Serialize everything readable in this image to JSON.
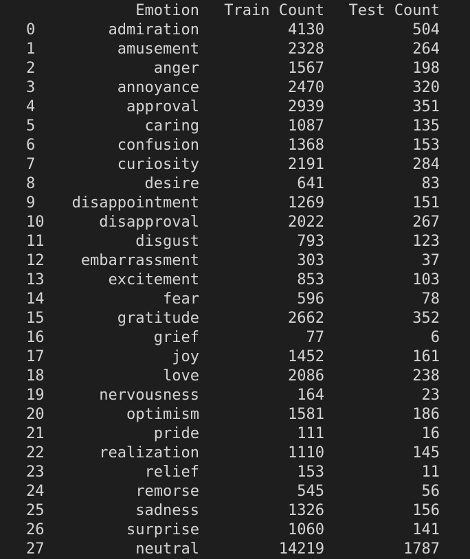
{
  "columns": {
    "index": "",
    "emotion": "Emotion",
    "train": "Train Count",
    "test": "Test Count"
  },
  "rows": [
    {
      "index": "0",
      "emotion": "admiration",
      "train": "4130",
      "test": "504"
    },
    {
      "index": "1",
      "emotion": "amusement",
      "train": "2328",
      "test": "264"
    },
    {
      "index": "2",
      "emotion": "anger",
      "train": "1567",
      "test": "198"
    },
    {
      "index": "3",
      "emotion": "annoyance",
      "train": "2470",
      "test": "320"
    },
    {
      "index": "4",
      "emotion": "approval",
      "train": "2939",
      "test": "351"
    },
    {
      "index": "5",
      "emotion": "caring",
      "train": "1087",
      "test": "135"
    },
    {
      "index": "6",
      "emotion": "confusion",
      "train": "1368",
      "test": "153"
    },
    {
      "index": "7",
      "emotion": "curiosity",
      "train": "2191",
      "test": "284"
    },
    {
      "index": "8",
      "emotion": "desire",
      "train": "641",
      "test": "83"
    },
    {
      "index": "9",
      "emotion": "disappointment",
      "train": "1269",
      "test": "151"
    },
    {
      "index": "10",
      "emotion": "disapproval",
      "train": "2022",
      "test": "267"
    },
    {
      "index": "11",
      "emotion": "disgust",
      "train": "793",
      "test": "123"
    },
    {
      "index": "12",
      "emotion": "embarrassment",
      "train": "303",
      "test": "37"
    },
    {
      "index": "13",
      "emotion": "excitement",
      "train": "853",
      "test": "103"
    },
    {
      "index": "14",
      "emotion": "fear",
      "train": "596",
      "test": "78"
    },
    {
      "index": "15",
      "emotion": "gratitude",
      "train": "2662",
      "test": "352"
    },
    {
      "index": "16",
      "emotion": "grief",
      "train": "77",
      "test": "6"
    },
    {
      "index": "17",
      "emotion": "joy",
      "train": "1452",
      "test": "161"
    },
    {
      "index": "18",
      "emotion": "love",
      "train": "2086",
      "test": "238"
    },
    {
      "index": "19",
      "emotion": "nervousness",
      "train": "164",
      "test": "23"
    },
    {
      "index": "20",
      "emotion": "optimism",
      "train": "1581",
      "test": "186"
    },
    {
      "index": "21",
      "emotion": "pride",
      "train": "111",
      "test": "16"
    },
    {
      "index": "22",
      "emotion": "realization",
      "train": "1110",
      "test": "145"
    },
    {
      "index": "23",
      "emotion": "relief",
      "train": "153",
      "test": "11"
    },
    {
      "index": "24",
      "emotion": "remorse",
      "train": "545",
      "test": "56"
    },
    {
      "index": "25",
      "emotion": "sadness",
      "train": "1326",
      "test": "156"
    },
    {
      "index": "26",
      "emotion": "surprise",
      "train": "1060",
      "test": "141"
    },
    {
      "index": "27",
      "emotion": "neutral",
      "train": "14219",
      "test": "1787"
    }
  ],
  "colors": {
    "background": "#1e1e1e",
    "text": "#d4d4d4"
  }
}
